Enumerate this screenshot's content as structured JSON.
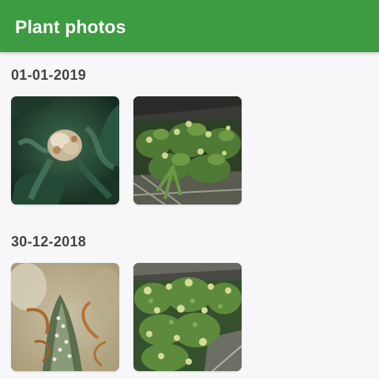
{
  "app": {
    "title": "Plant photos"
  },
  "sections": [
    {
      "date": "01-01-2019",
      "photos": [
        {
          "icon": "plant-photo-bud-closeup-icon"
        },
        {
          "icon": "plant-photo-canopy-icon"
        }
      ]
    },
    {
      "date": "30-12-2018",
      "photos": [
        {
          "icon": "plant-photo-trichome-closeup-icon"
        },
        {
          "icon": "plant-photo-flowering-canopy-icon"
        }
      ]
    }
  ],
  "colors": {
    "app_bar": "#3d9b41",
    "background": "#f7f7f9",
    "date_text": "#444444"
  }
}
